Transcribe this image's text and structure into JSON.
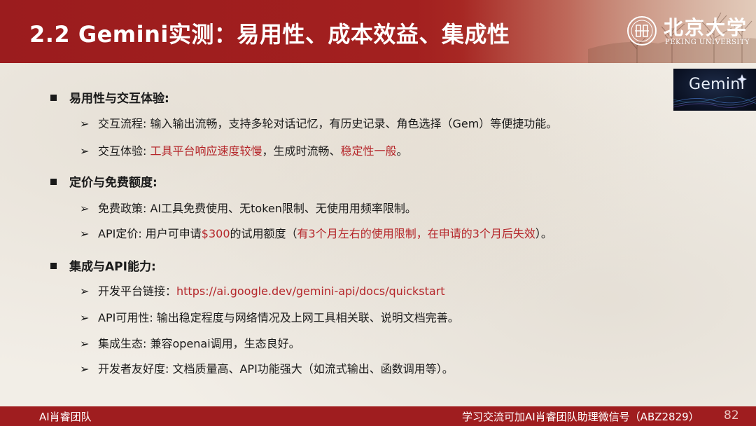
{
  "header": {
    "title": "2.2 Gemini实测：易用性、成本效益、集成性",
    "university_name_cn": "北京大学",
    "university_name_en": "PEKING UNIVERSITY"
  },
  "badge": {
    "text": "Gemini"
  },
  "sections": [
    {
      "heading": "易用性与交互体验:",
      "items": [
        {
          "segments": [
            {
              "text": "交互流程: 输入输出流畅，支持多轮对话记忆，有历史记录、角色选择（Gem）等便捷功能。",
              "highlight": false
            }
          ]
        },
        {
          "segments": [
            {
              "text": "交互体验: ",
              "highlight": false
            },
            {
              "text": "工具平台响应速度较慢",
              "highlight": true
            },
            {
              "text": "，生成时流畅、",
              "highlight": false
            },
            {
              "text": "稳定性一般",
              "highlight": true
            },
            {
              "text": "。",
              "highlight": false
            }
          ]
        }
      ]
    },
    {
      "heading": "定价与免费额度:",
      "items": [
        {
          "segments": [
            {
              "text": "免费政策: AI工具免费使用、无token限制、无使用用频率限制。",
              "highlight": false
            }
          ]
        },
        {
          "segments": [
            {
              "text": "API定价: 用户可申请",
              "highlight": false
            },
            {
              "text": "$300",
              "highlight": true
            },
            {
              "text": "的试用额度（",
              "highlight": false
            },
            {
              "text": "有3个月左右的使用限制，在申请的3个月后失效",
              "highlight": true
            },
            {
              "text": "）。",
              "highlight": false
            }
          ]
        }
      ]
    },
    {
      "heading": "集成与API能力:",
      "items": [
        {
          "segments": [
            {
              "text": "开发平台链接：",
              "highlight": false
            },
            {
              "text": "https://ai.google.dev/gemini-api/docs/quickstart",
              "highlight": true
            }
          ]
        },
        {
          "segments": [
            {
              "text": "API可用性: 输出稳定程度与网络情况及上网工具相关联、说明文档完善。",
              "highlight": false
            }
          ]
        },
        {
          "segments": [
            {
              "text": "集成生态: 兼容openai调用，生态良好。",
              "highlight": false
            }
          ]
        },
        {
          "segments": [
            {
              "text": "开发者友好度: 文档质量高、API功能强大（如流式输出、函数调用等）。",
              "highlight": false
            }
          ]
        }
      ]
    }
  ],
  "footer": {
    "left": "AI肖睿团队",
    "right": "学习交流可加AI肖睿团队助理微信号（ABZ2829）",
    "page_number": "82"
  },
  "colors": {
    "brand_red": "#9f1d1f",
    "highlight_red": "#b5262a",
    "text": "#1a1a1a"
  },
  "icons": {
    "section_bullet": "square-bullet-icon",
    "item_bullet": "arrow-bullet-icon",
    "logo": "pku-emblem-icon"
  }
}
